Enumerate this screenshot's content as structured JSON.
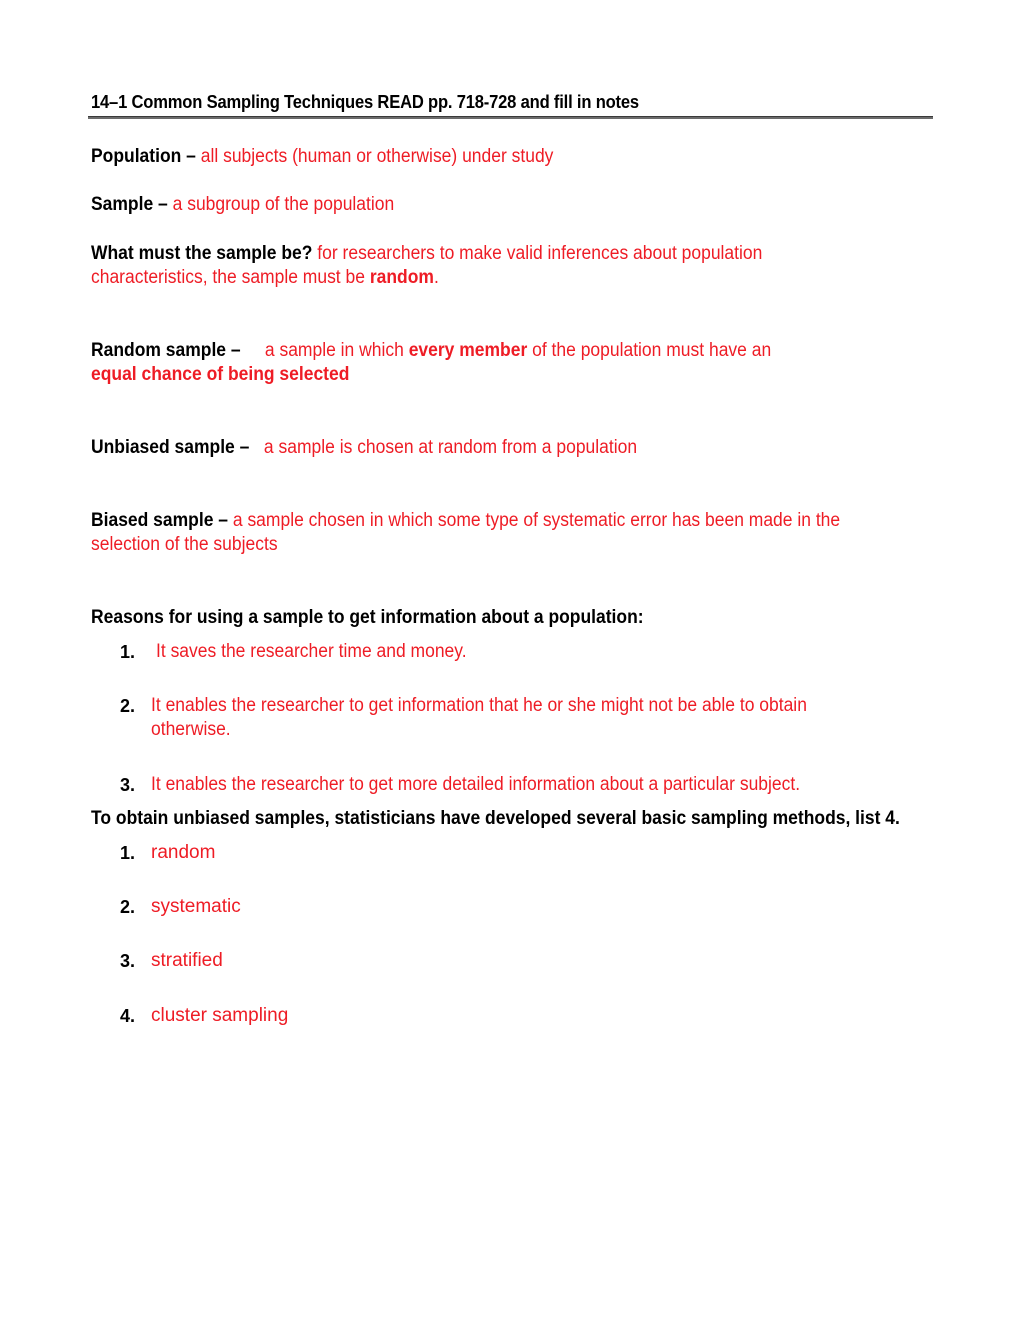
{
  "title": "14–1 Common Sampling Techniques READ pp. 718-728 and fill in notes",
  "population": {
    "label": "Population –",
    "answer": "all subjects (human or otherwise) under study"
  },
  "sample": {
    "label": "Sample –",
    "answer": "a subgroup of the population"
  },
  "what_must": {
    "label": "What must the sample be?",
    "answer_line1": "for researchers to make valid inferences about population",
    "answer_line2_pre": "characteristics, the sample must be ",
    "answer_line2_bold": "random",
    "answer_line2_post": "."
  },
  "random_sample": {
    "label": "Random sample –",
    "answer_pre": "a sample in which ",
    "answer_bold": "every member",
    "answer_post": " of the population must have an",
    "answer_line2_bold": "equal chance of being selected"
  },
  "unbiased_sample": {
    "label": "Unbiased sample –",
    "answer": "a sample is chosen at random from a population"
  },
  "biased_sample": {
    "label": "Biased sample –",
    "answer_line1": "a sample chosen in which some type of systematic error has been made in the",
    "answer_line2": "selection of the subjects"
  },
  "reasons": {
    "heading": "Reasons for using a sample to get information about a population:",
    "items": [
      {
        "num": "1.",
        "text": "It saves the researcher time and money."
      },
      {
        "num": "2.",
        "text": "It enables the researcher to get information that he or she might not be able to obtain",
        "text2": "otherwise."
      },
      {
        "num": "3.",
        "text": "It enables the researcher to get more detailed information about a particular subject."
      }
    ]
  },
  "methods": {
    "heading": "To obtain unbiased samples, statisticians have developed several basic sampling methods, list 4.",
    "items": [
      {
        "num": "1.",
        "text": "random"
      },
      {
        "num": "2.",
        "text": "systematic"
      },
      {
        "num": "3.",
        "text": "stratified"
      },
      {
        "num": "4.",
        "text": "cluster sampling"
      }
    ]
  },
  "colors": {
    "answer": "#ee1c25",
    "label": "#000000",
    "rule": "#6b6b6b"
  }
}
